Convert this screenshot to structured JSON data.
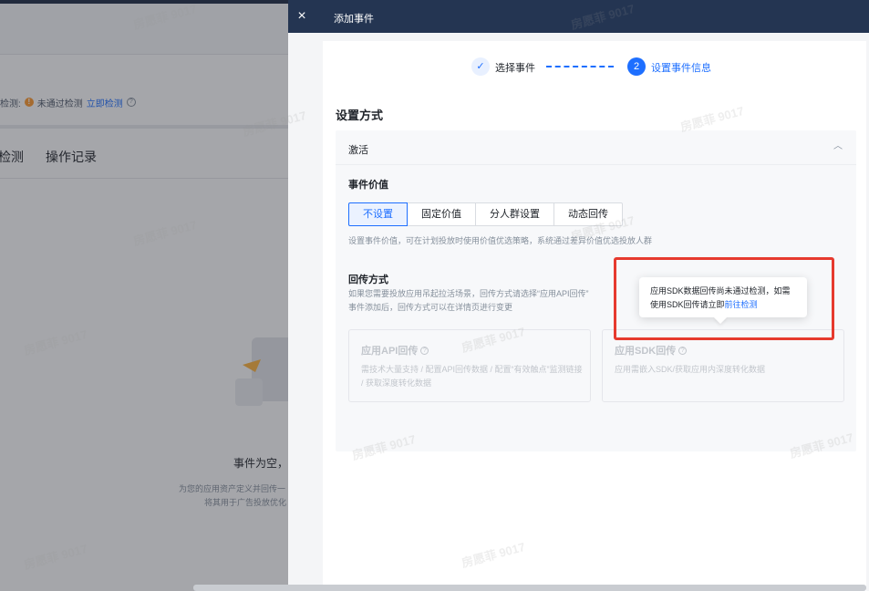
{
  "background": {
    "detect_prefix": "检测:",
    "detect_status": "未通过检测",
    "detect_link": "立即检测",
    "tabs": [
      "检测",
      "操作记录"
    ],
    "empty_title": "事件为空，请",
    "empty_desc_line1": "为您的应用资产定义并回传一",
    "empty_desc_line2": "将其用于广告投放优化"
  },
  "drawer": {
    "close_label": "×",
    "title": "添加事件",
    "steps": {
      "step1_label": "选择事件",
      "step1_icon": "✓",
      "step2_number": "2",
      "step2_label": "设置事件信息"
    },
    "section_title": "设置方式",
    "panel": {
      "title": "激活",
      "event_value_label": "事件价值",
      "event_value_options": [
        "不设置",
        "固定价值",
        "分人群设置",
        "动态回传"
      ],
      "event_value_selected": "不设置",
      "event_value_hint": "设置事件价值，可在计划投放时使用价值优选策略，系统通过差异价值优选投放人群",
      "callback_label": "回传方式",
      "callback_hint_line1": "如果您需要投放应用吊起拉活场景，回传方式请选择“应用API回传”",
      "callback_hint_line2": "事件添加后，回传方式可以在详情页进行变更",
      "options": [
        {
          "title": "应用API回传",
          "desc": "需技术大量支持 / 配置API回传数据 / 配置“有效触点”监测链接 / 获取深度转化数据"
        },
        {
          "title": "应用SDK回传",
          "desc": "应用需嵌入SDK/获取应用内深度转化数据"
        }
      ]
    },
    "tooltip": {
      "text_line1": "应用SDK数据回传尚未通过检测，如需",
      "text_line2_prefix": "使用SDK回传请立即",
      "link": "前往检测"
    }
  },
  "watermark": "房愿菲 9017",
  "colors": {
    "accent": "#1e6fff",
    "header_bg": "#243552",
    "highlight_border": "#e63a2e",
    "warning": "#ff9a2e"
  },
  "icons": [
    "close-icon",
    "check-icon",
    "chevron-up-icon",
    "help-icon",
    "warning-icon"
  ]
}
